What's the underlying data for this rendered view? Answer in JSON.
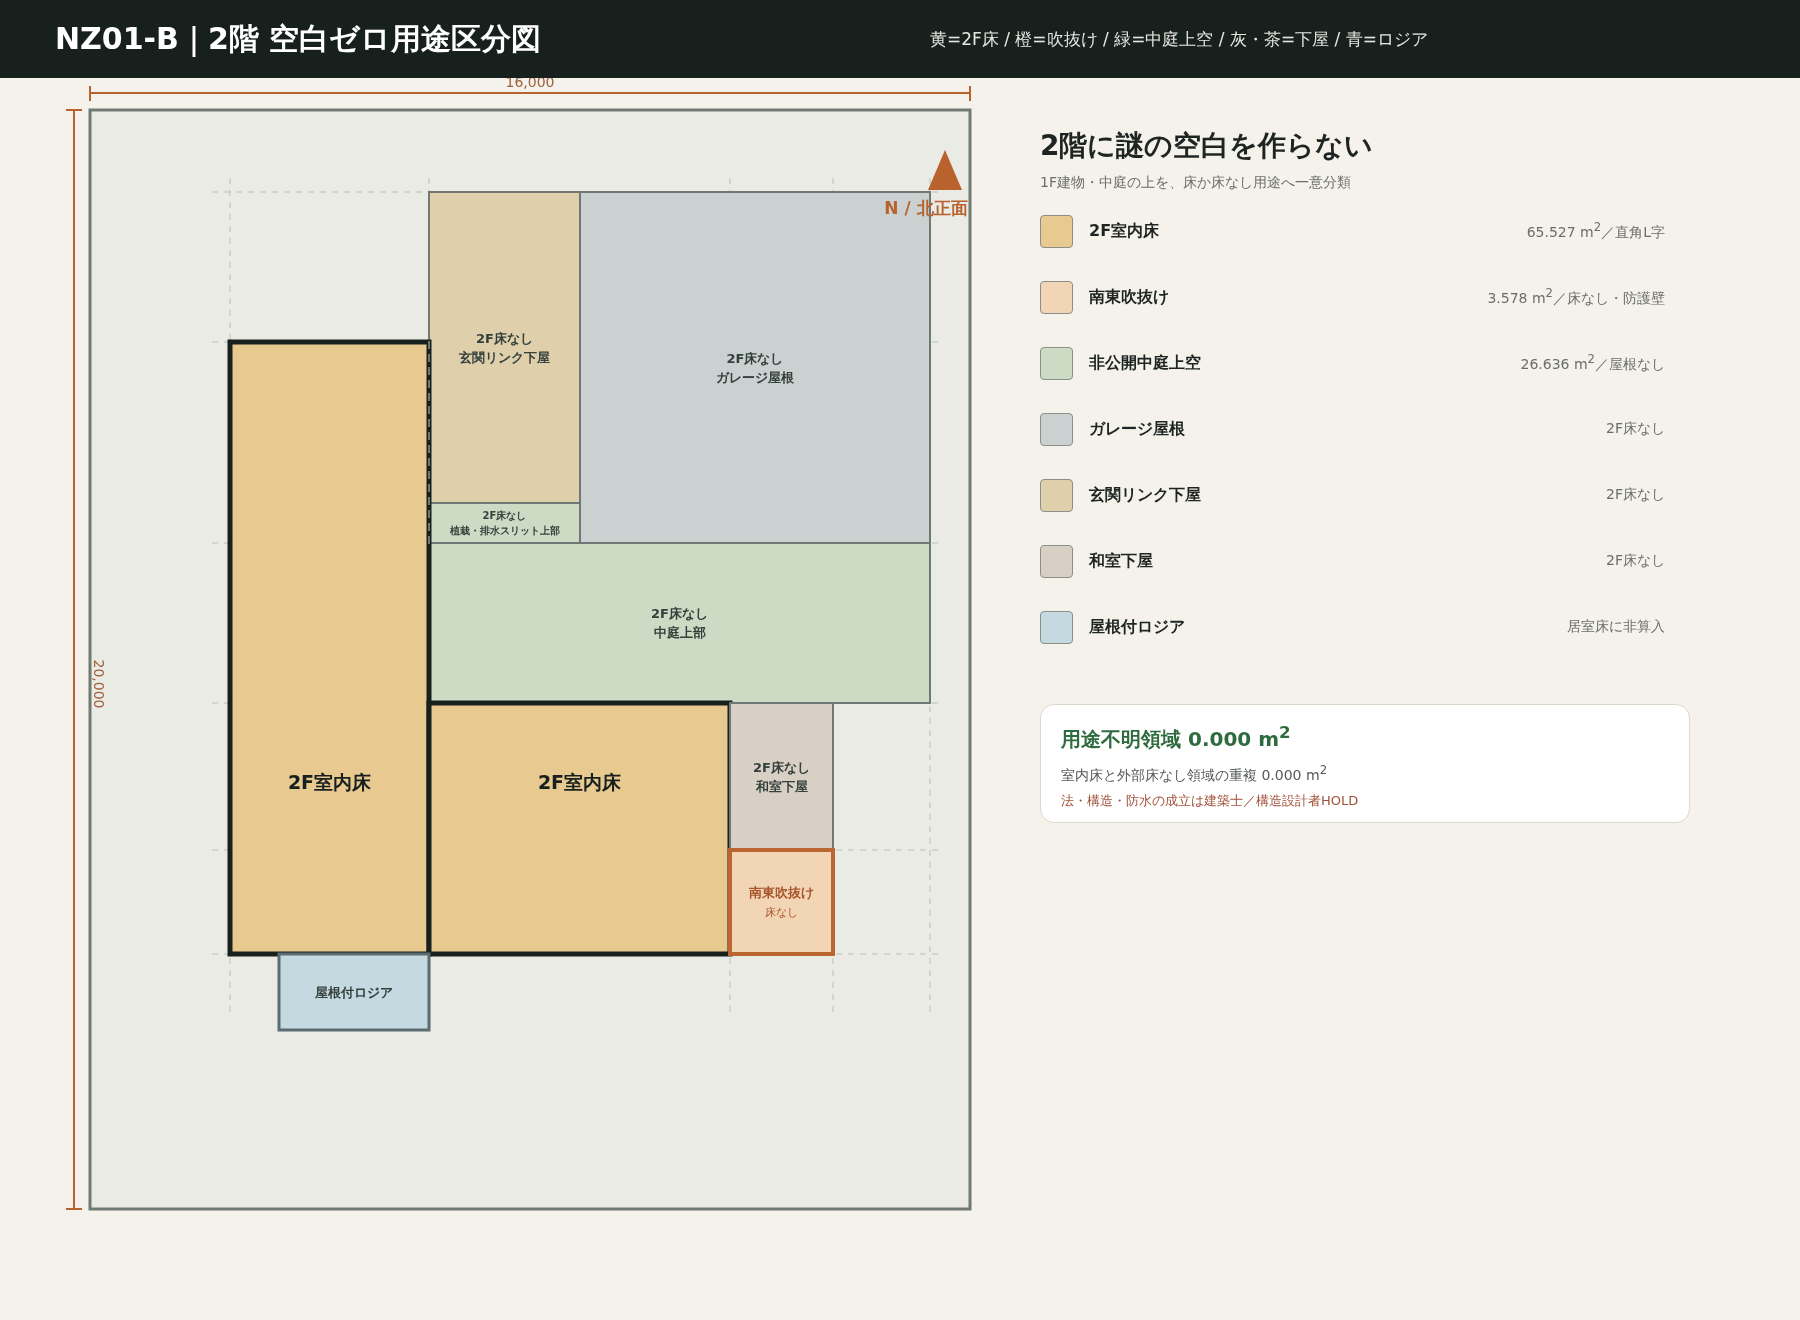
{
  "header": {
    "title": "NZ01-B｜2階 空白ゼロ用途区分図",
    "color_key": "黄=2F床 / 橙=吹抜け / 緑=中庭上空 / 灰・茶=下屋 / 青=ロジア"
  },
  "plan": {
    "width_dimension": "16,000",
    "depth_dimension": "20,000",
    "north_label": "N / 北正面",
    "zones": [
      {
        "kind": "none",
        "lines": [
          "2F床なし",
          "玄関リンク下屋"
        ],
        "color": "#dfcfab"
      },
      {
        "kind": "none",
        "lines": [
          "2F床なし",
          "ガレージ屋根"
        ],
        "color": "#cbd1d1"
      },
      {
        "kind": "none",
        "lines": [
          "2F床なし",
          "植栽・排水スリット上部"
        ],
        "color": "#cddbc5"
      },
      {
        "kind": "none",
        "lines": [
          "2F床なし",
          "中庭上部"
        ],
        "color": "#cddbc5"
      },
      {
        "kind": "floor",
        "lines": [
          "2F室内床"
        ],
        "color": "#e8ca90"
      },
      {
        "kind": "floor",
        "lines": [
          "2F室内床"
        ],
        "color": "#e8ca90"
      },
      {
        "kind": "none",
        "lines": [
          "2F床なし",
          "和室下屋"
        ],
        "color": "#d8d0c4"
      },
      {
        "kind": "void",
        "lines": [
          "南東吹抜け",
          "床なし"
        ],
        "color": "#f2d5b5"
      },
      {
        "kind": "loggia",
        "lines": [
          "屋根付ロジア"
        ],
        "color": "#c5d9e0"
      }
    ]
  },
  "panel": {
    "title": "2階に謎の空白を作らない",
    "subtitle": "1F建物・中庭の上を、床か床なし用途へ一意分類",
    "legend": [
      {
        "label": "2F室内床",
        "note": "65.527 m$^{2}$／直角L字",
        "color": "#e8ca90"
      },
      {
        "label": "南東吹抜け",
        "note": "3.578 m$^{2}$／床なし・防護壁",
        "color": "#f2d5b5"
      },
      {
        "label": "非公開中庭上空",
        "note": "26.636 m$^{2}$／屋根なし",
        "color": "#cddbc5"
      },
      {
        "label": "ガレージ屋根",
        "note": "2F床なし",
        "color": "#cbd1d1"
      },
      {
        "label": "玄関リンク下屋",
        "note": "2F床なし",
        "color": "#dfcfab"
      },
      {
        "label": "和室下屋",
        "note": "2F床なし",
        "color": "#d8d0c4"
      },
      {
        "label": "屋根付ロジア",
        "note": "居室床に非算入",
        "color": "#c5d9e0"
      }
    ],
    "summary": {
      "title": "用途不明領域 0.000 m$^{2}$",
      "text": "室内床と外部床なし領域の重複 0.000 m$^{2}$",
      "note": "法・構造・防水の成立は建築士／構造設計者HOLD"
    }
  }
}
